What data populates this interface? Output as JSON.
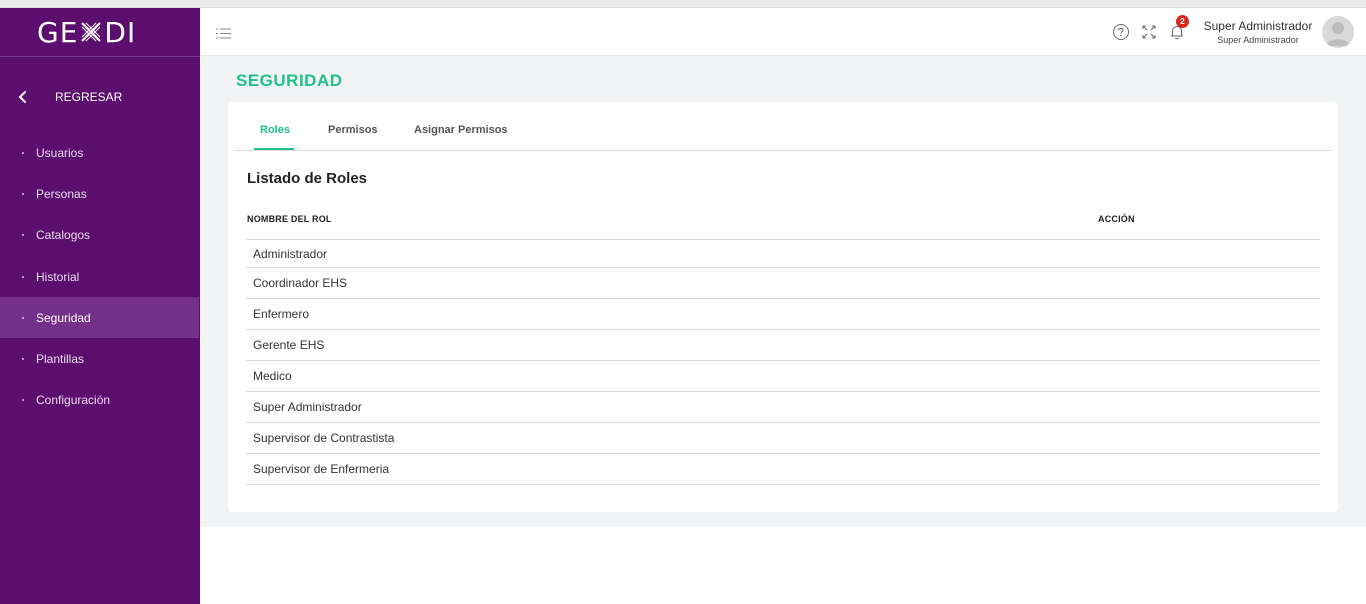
{
  "app": {
    "logo_text_left": "GE",
    "logo_text_right": "DI"
  },
  "sidebar": {
    "back_label": "REGRESAR",
    "items": [
      {
        "label": "Usuarios"
      },
      {
        "label": "Personas"
      },
      {
        "label": "Catalogos"
      },
      {
        "label": "Historial"
      },
      {
        "label": "Seguridad",
        "active": true
      },
      {
        "label": "Plantillas"
      },
      {
        "label": "Configuración"
      }
    ]
  },
  "header": {
    "notifications_count": "2",
    "user_name": "Super Administrador",
    "user_role": "Super Administrador",
    "icons": [
      "menu-icon",
      "help-icon",
      "fullscreen-icon",
      "bell-icon",
      "avatar"
    ]
  },
  "page": {
    "title": "SEGURIDAD",
    "tabs": [
      {
        "label": "Roles",
        "active": true
      },
      {
        "label": "Permisos"
      },
      {
        "label": "Asignar Permisos"
      }
    ],
    "section_title": "Listado de Roles",
    "table": {
      "headers": [
        "NOMBRE DEL ROL",
        "ACCIÓN"
      ],
      "rows": [
        "Administrador",
        "Coordinador EHS",
        "Enfermero",
        "Gerente EHS",
        "Medico",
        "Super Administrador",
        "Supervisor de Contrastista",
        "Supervisor de Enfermeria"
      ]
    }
  },
  "colors": {
    "sidebar": "#5b0e6e",
    "sidebar_active": "#75308a",
    "accent": "#1fc288",
    "badge": "#d7261e"
  }
}
